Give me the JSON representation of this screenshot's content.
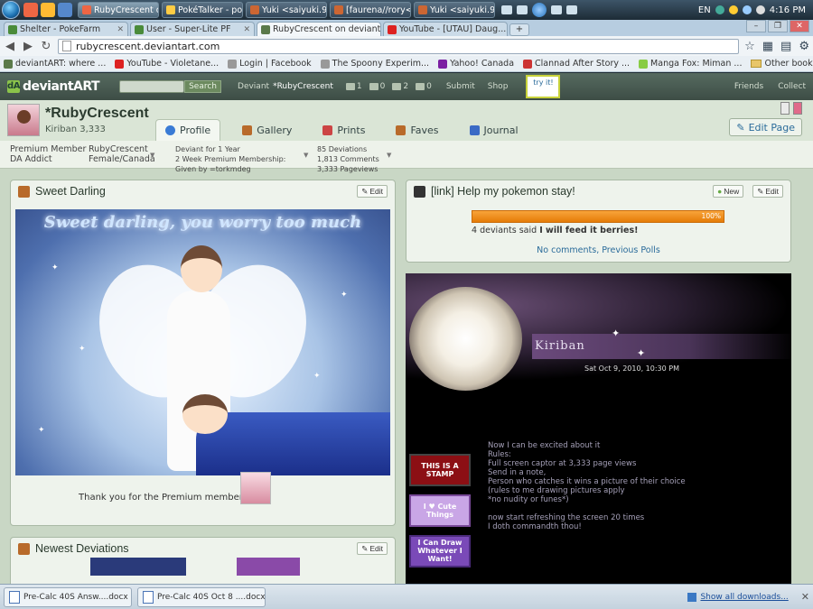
{
  "taskbar": {
    "windows": [
      "RubyCrescent o...",
      "PokéTalker - po...",
      "Yuki <saiyuki.93....",
      "[faurena//rory<...",
      "Yuki <saiyuki.93...."
    ],
    "lang": "EN",
    "time": "4:16 PM"
  },
  "browser": {
    "tabs": [
      "Shelter - PokeFarm",
      "User - Super-Lite PF",
      "RubyCrescent on deviant...",
      "YouTube - [UTAU] Daug..."
    ],
    "url": "rubycrescent.deviantart.com",
    "bookmarks": [
      "deviantART: where ...",
      "YouTube - Violetane...",
      "Login | Facebook",
      "The Spoony Experim...",
      "Yahoo! Canada",
      "Clannad After Story ...",
      "Manga Fox: Miman ..."
    ],
    "other_bookmarks": "Other bookmarks"
  },
  "da_bar": {
    "logo": "deviantART",
    "search_btn": "Search",
    "deviant_label": "Deviant",
    "username": "*RubyCrescent",
    "count_1": "1",
    "count_2": "0",
    "count_3": "2",
    "count_4": "0",
    "submit": "Submit",
    "shop": "Shop",
    "try_it": "try it!",
    "friends": "Friends",
    "collect": "Collect"
  },
  "profile": {
    "username": "*RubyCrescent",
    "kiriban": "Kiriban 3,333",
    "tabs": [
      "Profile",
      "Gallery",
      "Prints",
      "Faves",
      "Journal"
    ],
    "edit_page": "Edit Page",
    "info": {
      "membership": "Premium Member",
      "role": "DA Addict",
      "name": "RubyCrescent",
      "gender_loc": "Female/Canada",
      "deviant_for": "Deviant for 1 Year",
      "premium": "2 Week Premium Membership:",
      "given_by": "Given by =torkmdeg",
      "deviations": "85 Deviations",
      "comments": "1,813 Comments",
      "pageviews": "3,333 Pageviews"
    }
  },
  "sweet_darling": {
    "title": "Sweet Darling",
    "edit": "Edit",
    "art_title": "Sweet darling, you worry too much",
    "thanks": "Thank you for the Premium membership"
  },
  "newest": {
    "title": "Newest Deviations",
    "edit": "Edit"
  },
  "poll": {
    "title": "[link] Help my pokemon stay!",
    "new": "New",
    "edit": "Edit",
    "percent": "100%",
    "result_prefix": "4 deviants said",
    "result_answer": "I will feed it berries!",
    "no_comments": "No comments",
    "previous": "Previous Polls"
  },
  "journal": {
    "title": "Kiriban",
    "date": "Sat Oct 9, 2010, 10:30 PM",
    "body": "Now I can be excited about it\nRules:\nFull screen captor at 3,333 page views\nSend in a note,\nPerson who catches it wins a picture of their choice\n(rules to me drawing pictures apply\n*no nudity or funes*)\n\nnow start refreshing the screen 20 times\nI doth commandth thou!",
    "stamps": [
      "THIS IS A STAMP",
      "I ♥ Cute Things",
      "I Can Draw Whatever I Want!"
    ]
  },
  "downloads": {
    "items": [
      "Pre-Calc 40S Answ....docx",
      "Pre-Calc 40S Oct 8 ....docx"
    ],
    "show_all": "Show all downloads..."
  }
}
